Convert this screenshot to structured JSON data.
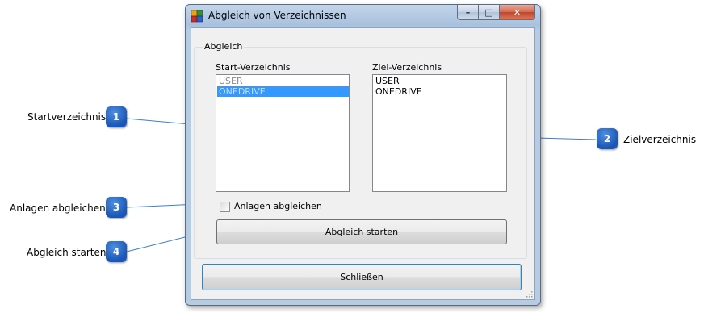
{
  "window": {
    "title": "Abgleich von Verzeichnissen",
    "minimize_glyph": "–",
    "maximize_glyph": "□",
    "close_glyph": "✕"
  },
  "group": {
    "legend": "Abgleich",
    "start_label": "Start-Verzeichnis",
    "target_label": "Ziel-Verzeichnis",
    "start_items": [
      {
        "text": "USER",
        "state": "disabled"
      },
      {
        "text": "ONEDRIVE",
        "state": "selected"
      }
    ],
    "target_items": [
      {
        "text": "USER"
      },
      {
        "text": "ONEDRIVE"
      }
    ],
    "checkbox_label": "Anlagen abgleichen",
    "checkbox_checked": false,
    "start_button": "Abgleich starten"
  },
  "close_button": "Schließen",
  "callouts": [
    {
      "number": "1",
      "label": "Startverzeichnis"
    },
    {
      "number": "2",
      "label": "Zielverzeichnis"
    },
    {
      "number": "3",
      "label": "Anlagen abgleichen"
    },
    {
      "number": "4",
      "label": "Abgleich starten"
    }
  ],
  "colors": {
    "badge": "#1a56b5",
    "callout_line": "#3a7fd0",
    "selection": "#3399ff"
  }
}
